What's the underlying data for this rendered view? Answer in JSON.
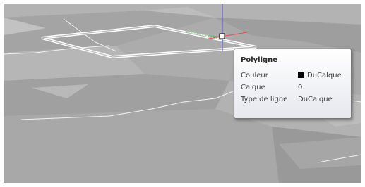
{
  "tooltip": {
    "title": "Polyligne",
    "rows": [
      {
        "label": "Couleur",
        "value": "DuCalque",
        "swatch_color": "#000000"
      },
      {
        "label": "Calque",
        "value": "0"
      },
      {
        "label": "Type de ligne",
        "value": "DuCalque"
      }
    ]
  },
  "colors": {
    "viewport_background": "#a9a9a9",
    "polyline_highlight": "#ffffff",
    "axis_y": "#5b5bd6",
    "axis_x": "#e05050",
    "axis_z": "#4fbf4f"
  }
}
